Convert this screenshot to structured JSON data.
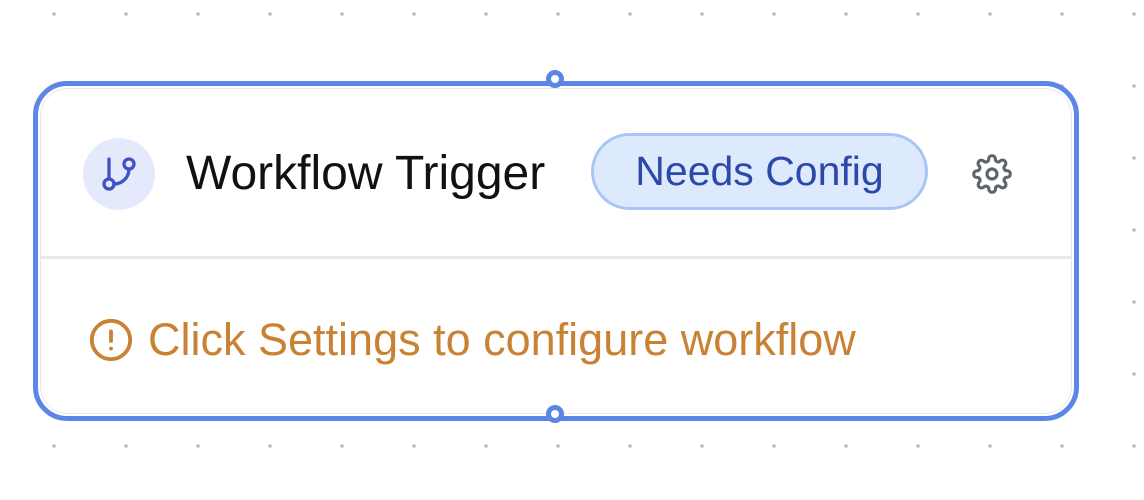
{
  "node": {
    "type_icon": "git-branch-icon",
    "title": "Workflow Trigger",
    "status_badge": "Needs Config",
    "settings_icon": "gear-icon",
    "message_icon": "alert-circle-icon",
    "message": "Click Settings to configure workflow"
  },
  "colors": {
    "accent": "#5b86e6",
    "icon_bg": "#e4e9fb",
    "icon_fg": "#4052c4",
    "badge_bg": "#dde9fc",
    "badge_border": "#a7c6f5",
    "badge_text": "#2c48a8",
    "warning": "#c98234"
  }
}
